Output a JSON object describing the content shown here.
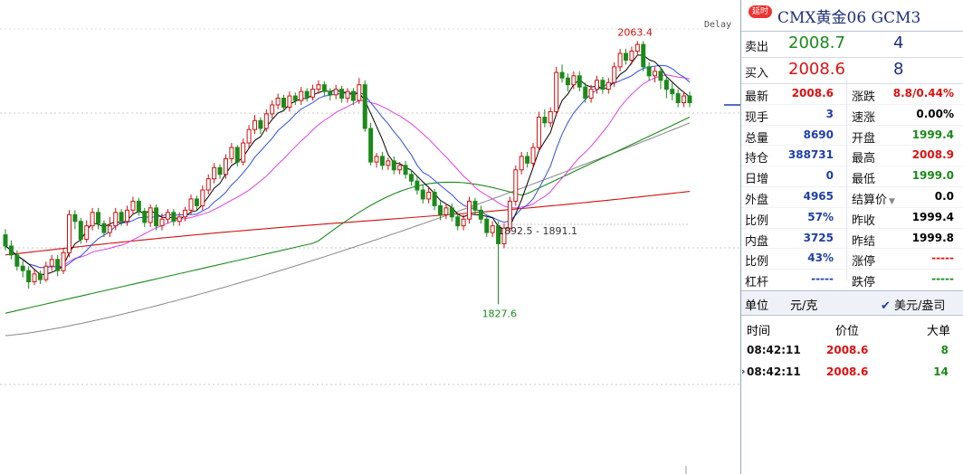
{
  "chart": {
    "delay_label": "Delay",
    "high_label": "2063.4",
    "low_label": "1827.6",
    "range_label": "1892.5 - 1891.1"
  },
  "panel": {
    "delay_badge": "延时",
    "title": "CMX黄金06  GCM3",
    "sell": {
      "label": "卖出",
      "price": "2008.7",
      "volume": "4"
    },
    "buy": {
      "label": "买入",
      "price": "2008.6",
      "volume": "8"
    },
    "quotes": [
      {
        "l": "最新",
        "v": "2008.6",
        "v_color": "red",
        "r": "涨跌",
        "rv": "8.8/0.44%",
        "rv_color": "red"
      },
      {
        "l": "现手",
        "v": "3",
        "v_color": "blue",
        "r": "速涨",
        "rv": "0.00%",
        "rv_color": "black"
      },
      {
        "l": "总量",
        "v": "8690",
        "v_color": "blue",
        "r": "开盘",
        "rv": "1999.4",
        "rv_color": "green"
      },
      {
        "l": "持仓",
        "v": "388731",
        "v_color": "blue",
        "r": "最高",
        "rv": "2008.9",
        "rv_color": "red"
      },
      {
        "l": "日增",
        "v": "0",
        "v_color": "blue",
        "r": "最低",
        "rv": "1999.0",
        "rv_color": "green"
      },
      {
        "l": "外盘",
        "v": "4965",
        "v_color": "blue",
        "r": "结算价",
        "rv": "0.0",
        "rv_color": "black"
      },
      {
        "l": "比例",
        "v": "57%",
        "v_color": "blue",
        "r": "昨收",
        "rv": "1999.4",
        "rv_color": "black"
      },
      {
        "l": "内盘",
        "v": "3725",
        "v_color": "blue",
        "r": "昨结",
        "rv": "1999.8",
        "rv_color": "black"
      },
      {
        "l": "比例",
        "v": "43%",
        "v_color": "blue",
        "r": "涨停",
        "rv": "-----",
        "rv_color": "red"
      },
      {
        "l": "杠杆",
        "v": "-----",
        "v_color": "blue",
        "r": "跌停",
        "rv": "-----",
        "rv_color": "green"
      }
    ],
    "unit": {
      "label": "单位",
      "value": "元/克",
      "toggle": "美元/盎司",
      "toggle_icon": "check-icon"
    },
    "ticks_header": {
      "time": "时间",
      "price": "价位",
      "volume": "大单"
    },
    "ticks": [
      {
        "time": "08:42:11",
        "price": "2008.6",
        "volume": "8",
        "vol_color": "green"
      },
      {
        "time": "08:42:11",
        "price": "2008.6",
        "volume": "14",
        "vol_color": "green"
      }
    ]
  },
  "chart_data": {
    "type": "candlestick",
    "y_range": [
      1720,
      2090
    ],
    "candles": [
      [
        1890,
        1880,
        1895,
        1876
      ],
      [
        1880,
        1872,
        1885,
        1868
      ],
      [
        1872,
        1862,
        1876,
        1858
      ],
      [
        1862,
        1858,
        1868,
        1852
      ],
      [
        1858,
        1848,
        1862,
        1842
      ],
      [
        1848,
        1855,
        1860,
        1845
      ],
      [
        1855,
        1850,
        1858,
        1846
      ],
      [
        1850,
        1862,
        1866,
        1848
      ],
      [
        1862,
        1868,
        1872,
        1858
      ],
      [
        1868,
        1858,
        1872,
        1853
      ],
      [
        1858,
        1874,
        1878,
        1855
      ],
      [
        1874,
        1908,
        1912,
        1870
      ],
      [
        1908,
        1902,
        1912,
        1895
      ],
      [
        1902,
        1886,
        1905,
        1882
      ],
      [
        1886,
        1898,
        1903,
        1883
      ],
      [
        1898,
        1910,
        1914,
        1894
      ],
      [
        1910,
        1900,
        1914,
        1895
      ],
      [
        1900,
        1892,
        1903,
        1888
      ],
      [
        1892,
        1898,
        1906,
        1888
      ],
      [
        1898,
        1910,
        1914,
        1894
      ],
      [
        1910,
        1902,
        1913,
        1898
      ],
      [
        1902,
        1912,
        1916,
        1898
      ],
      [
        1912,
        1920,
        1924,
        1908
      ],
      [
        1920,
        1911,
        1923,
        1907
      ],
      [
        1911,
        1901,
        1914,
        1897
      ],
      [
        1901,
        1914,
        1917,
        1897
      ],
      [
        1914,
        1898,
        1917,
        1894
      ],
      [
        1898,
        1904,
        1909,
        1894
      ],
      [
        1904,
        1910,
        1913,
        1900
      ],
      [
        1910,
        1902,
        1913,
        1898
      ],
      [
        1902,
        1906,
        1910,
        1898
      ],
      [
        1906,
        1912,
        1915,
        1902
      ],
      [
        1912,
        1922,
        1926,
        1908
      ],
      [
        1922,
        1916,
        1925,
        1912
      ],
      [
        1916,
        1930,
        1934,
        1912
      ],
      [
        1930,
        1940,
        1944,
        1926
      ],
      [
        1940,
        1950,
        1954,
        1936
      ],
      [
        1950,
        1944,
        1953,
        1940
      ],
      [
        1944,
        1958,
        1962,
        1940
      ],
      [
        1958,
        1968,
        1972,
        1954
      ],
      [
        1968,
        1955,
        1970,
        1951
      ],
      [
        1955,
        1972,
        1976,
        1952
      ],
      [
        1972,
        1984,
        1988,
        1968
      ],
      [
        1984,
        1992,
        1997,
        1980
      ],
      [
        1992,
        1985,
        1995,
        1980
      ],
      [
        1985,
        1998,
        2002,
        1982
      ],
      [
        1998,
        2006,
        2010,
        1994
      ],
      [
        2006,
        2012,
        2016,
        2002
      ],
      [
        2012,
        2004,
        2015,
        2000
      ],
      [
        2004,
        2014,
        2018,
        2000
      ],
      [
        2014,
        2010,
        2017,
        2006
      ],
      [
        2010,
        2018,
        2022,
        2006
      ],
      [
        2018,
        2013,
        2021,
        2009
      ],
      [
        2013,
        2020,
        2024,
        2010
      ],
      [
        2020,
        2024,
        2028,
        2016
      ],
      [
        2024,
        2018,
        2027,
        2014
      ],
      [
        2018,
        2015,
        2021,
        2010
      ],
      [
        2015,
        2020,
        2024,
        2011
      ],
      [
        2020,
        2012,
        2023,
        2008
      ],
      [
        2012,
        2018,
        2021,
        2008
      ],
      [
        2018,
        2010,
        2021,
        2006
      ],
      [
        2010,
        2024,
        2030,
        2007
      ],
      [
        2024,
        1985,
        2028,
        1982
      ],
      [
        1985,
        1955,
        1990,
        1952
      ],
      [
        1955,
        1960,
        1963,
        1950
      ],
      [
        1960,
        1952,
        1964,
        1948
      ],
      [
        1952,
        1956,
        1959,
        1948
      ],
      [
        1956,
        1948,
        1960,
        1944
      ],
      [
        1948,
        1952,
        1955,
        1944
      ],
      [
        1952,
        1944,
        1956,
        1940
      ],
      [
        1944,
        1938,
        1948,
        1934
      ],
      [
        1938,
        1930,
        1942,
        1926
      ],
      [
        1930,
        1922,
        1934,
        1918
      ],
      [
        1922,
        1928,
        1932,
        1918
      ],
      [
        1928,
        1916,
        1931,
        1912
      ],
      [
        1916,
        1908,
        1920,
        1903
      ],
      [
        1908,
        1914,
        1918,
        1904
      ],
      [
        1914,
        1906,
        1918,
        1902
      ],
      [
        1906,
        1898,
        1910,
        1894
      ],
      [
        1898,
        1904,
        1908,
        1894
      ],
      [
        1904,
        1920,
        1924,
        1900
      ],
      [
        1920,
        1912,
        1923,
        1908
      ],
      [
        1912,
        1904,
        1916,
        1900
      ],
      [
        1904,
        1892,
        1908,
        1888
      ],
      [
        1892,
        1898,
        1902,
        1888
      ],
      [
        1898,
        1882,
        1902,
        1828
      ],
      [
        1882,
        1896,
        1900,
        1878
      ],
      [
        1896,
        1920,
        1924,
        1892
      ],
      [
        1920,
        1948,
        1952,
        1916
      ],
      [
        1948,
        1960,
        1964,
        1944
      ],
      [
        1960,
        1954,
        1964,
        1950
      ],
      [
        1954,
        1968,
        1972,
        1950
      ],
      [
        1968,
        1995,
        2000,
        1964
      ],
      [
        1995,
        1990,
        2002,
        1986
      ],
      [
        1990,
        2000,
        2004,
        1986
      ],
      [
        2000,
        2035,
        2040,
        1996
      ],
      [
        2035,
        2030,
        2042,
        2026
      ],
      [
        2030,
        2024,
        2034,
        2018
      ],
      [
        2024,
        2032,
        2036,
        2020
      ],
      [
        2032,
        2022,
        2036,
        2018
      ],
      [
        2022,
        2012,
        2026,
        2008
      ],
      [
        2012,
        2020,
        2024,
        2008
      ],
      [
        2020,
        2028,
        2032,
        2016
      ],
      [
        2028,
        2020,
        2031,
        2016
      ],
      [
        2020,
        2026,
        2030,
        2016
      ],
      [
        2026,
        2040,
        2044,
        2022
      ],
      [
        2040,
        2052,
        2056,
        2036
      ],
      [
        2052,
        2046,
        2056,
        2042
      ],
      [
        2046,
        2054,
        2058,
        2042
      ],
      [
        2054,
        2060,
        2063,
        2050
      ],
      [
        2060,
        2040,
        2063,
        2036
      ],
      [
        2040,
        2032,
        2044,
        2028
      ],
      [
        2032,
        2036,
        2040,
        2026
      ],
      [
        2036,
        2028,
        2040,
        2020
      ],
      [
        2028,
        2020,
        2032,
        2012
      ],
      [
        2020,
        2016,
        2026,
        2010
      ],
      [
        2016,
        2008,
        2020,
        2004
      ],
      [
        2008,
        2014,
        2018,
        2004
      ],
      [
        2014,
        2008,
        2018,
        2004
      ]
    ],
    "ma_colors": [
      "#000000",
      "#3050e0",
      "#e040e0",
      "#1a8a1a",
      "#888888",
      "#d01010"
    ]
  }
}
